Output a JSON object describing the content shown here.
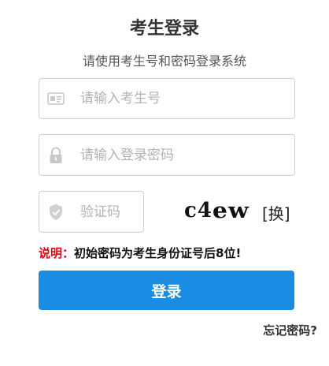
{
  "header": {
    "title": "考生登录",
    "subtitle": "请使用考生号和密码登录系统"
  },
  "form": {
    "username": {
      "placeholder": "请输入考生号",
      "value": "",
      "icon": "id-card-icon"
    },
    "password": {
      "placeholder": "请输入登录密码",
      "value": "",
      "icon": "lock-icon"
    },
    "captcha": {
      "placeholder": "验证码",
      "value": "",
      "icon": "shield-icon"
    },
    "captcha_image_text": {
      "part1": "c4",
      "part2": "ew"
    },
    "refresh_label": "[换]"
  },
  "notice": {
    "label": "说明：",
    "text": "初始密码为考生身份证号后8位!"
  },
  "actions": {
    "login_label": "登录",
    "forgot_label": "忘记密码?"
  },
  "colors": {
    "primary": "#1b8ce3",
    "notice_label": "#e60012",
    "border": "#cfcfcf",
    "placeholder": "#b3b3b3"
  }
}
